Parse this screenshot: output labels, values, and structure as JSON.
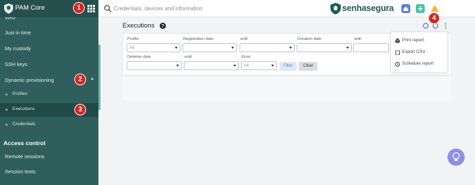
{
  "sidebar": {
    "title": "PAM Core",
    "items": [
      {
        "label": "Web"
      },
      {
        "label": "Just in time"
      },
      {
        "label": "My custody"
      },
      {
        "label": "SSH keys"
      },
      {
        "label": "Dynamic provisioning"
      }
    ],
    "sub_items": [
      {
        "label": "Profiles"
      },
      {
        "label": "Executions"
      },
      {
        "label": "Credentials"
      }
    ],
    "section": "Access control",
    "section_items": [
      {
        "label": "Remote sessions"
      },
      {
        "label": "Session texts"
      }
    ]
  },
  "search": {
    "placeholder": "Credentials, devices and information"
  },
  "brand": {
    "text": "senhasegura",
    "color": "#1d5c53"
  },
  "page": {
    "title": "Executions"
  },
  "filters": {
    "labels": {
      "profile": "Profile",
      "registration_date": "Registration date",
      "until1": "until",
      "creation_date": "Creation date",
      "until2": "until",
      "deletion_date": "Deletion date",
      "until3": "until",
      "error": "Error"
    },
    "profile_value": "All",
    "error_value": "All",
    "filter_label": "Filter",
    "clear_label": "Clear"
  },
  "menu": {
    "items": [
      {
        "label": "Print report",
        "icon": "printer-icon"
      },
      {
        "label": "Export CSV",
        "icon": "document-icon"
      },
      {
        "label": "Schedule report",
        "icon": "clock-icon"
      }
    ]
  },
  "markers": [
    "1",
    "2",
    "3",
    "4"
  ],
  "colors": {
    "sidebar": "#2e5f5c",
    "accent": "#4a78d1",
    "marker": "#d9231d"
  }
}
